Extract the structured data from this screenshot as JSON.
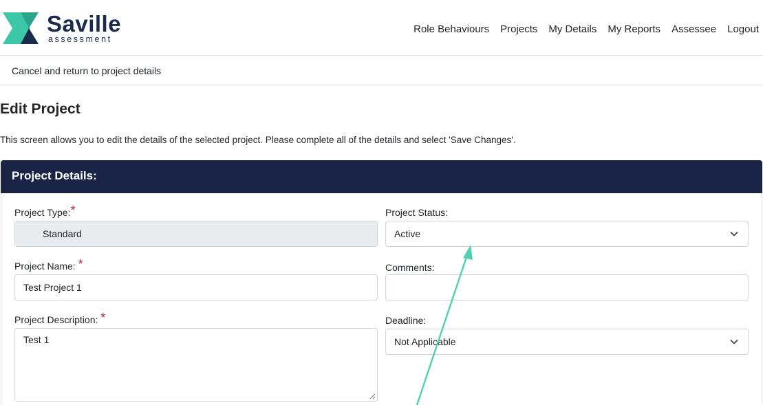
{
  "brand": {
    "name": "Saville",
    "tagline": "assessment",
    "primary_color": "#1a2b4c",
    "accent_color": "#3cc8a8"
  },
  "nav": {
    "items": [
      "Role Behaviours",
      "Projects",
      "My Details",
      "My Reports",
      "Assessee",
      "Logout"
    ]
  },
  "subnav": {
    "cancel_label": "Cancel and return to project details"
  },
  "page": {
    "title": "Edit Project",
    "intro": "This screen allows you to edit the details of the selected project. Please complete all of the details and select 'Save Changes'."
  },
  "panel": {
    "title": "Project Details:",
    "header_color": "#1a2447"
  },
  "form": {
    "project_type": {
      "label": "Project Type:",
      "required_mark": "*",
      "value": "Standard"
    },
    "project_name": {
      "label": "Project Name:",
      "required_mark": "*",
      "value": "Test Project 1"
    },
    "project_description": {
      "label": "Project Description:",
      "required_mark": "*",
      "value": "Test 1"
    },
    "project_status": {
      "label": "Project Status:",
      "value": "Active"
    },
    "comments": {
      "label": "Comments:",
      "value": ""
    },
    "deadline": {
      "label": "Deadline:",
      "value": "Not Applicable"
    }
  },
  "annotation": {
    "color": "#4fd1b3"
  }
}
